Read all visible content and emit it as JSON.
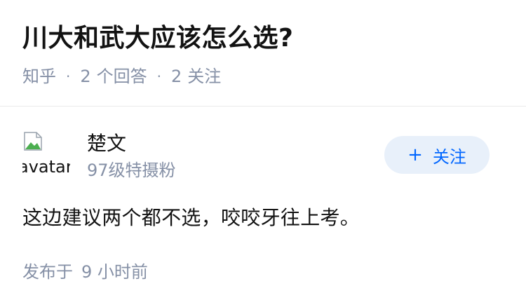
{
  "question": {
    "title": "川大和武大应该怎么选?",
    "source": "知乎",
    "answer_count": "2",
    "answer_label": "个回答",
    "follower_count": "2",
    "follower_label": "关注",
    "separator": "·"
  },
  "answer": {
    "author": {
      "name": "楚文",
      "headline": "97级特摄粉",
      "avatar_alt": "avatar",
      "avatar_icon": "broken-image-icon"
    },
    "follow_button": {
      "icon": "+",
      "label": "关注"
    },
    "content": "这边建议两个都不选，咬咬牙往上考。",
    "time_prefix": "发布于",
    "time": "9 小时前"
  },
  "colors": {
    "text_primary": "#121212",
    "text_secondary": "#8590a6",
    "accent": "#0066ff",
    "follow_bg": "#e8f0fa",
    "divider": "#ebebeb"
  }
}
